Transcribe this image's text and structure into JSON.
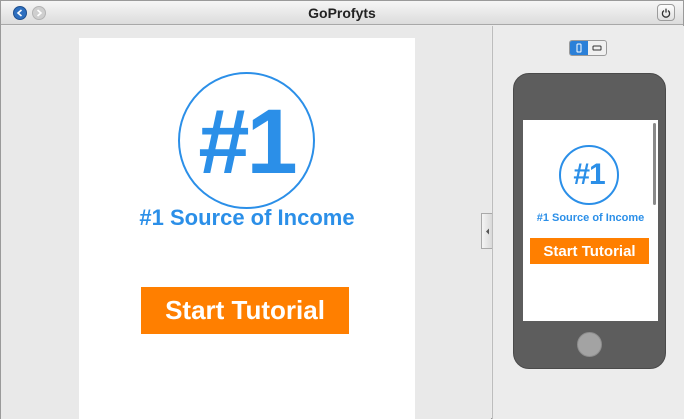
{
  "window": {
    "title": "GoProfyts"
  },
  "titlebar": {
    "back_icon": "arrow-left-icon",
    "forward_icon": "arrow-right-icon",
    "power_icon": "power-icon"
  },
  "page": {
    "badge_text": "#1",
    "headline": "#1 Source of Income",
    "start_button": "Start Tutorial"
  },
  "preview": {
    "orientation_options": [
      "portrait",
      "landscape"
    ],
    "selected_orientation": "portrait",
    "badge_text": "#1",
    "headline": "#1 Source of Income",
    "start_button": "Start Tutorial"
  },
  "colors": {
    "accent_blue": "#2b8fe8",
    "button_orange": "#ff7f00",
    "phone_body": "#5d5d5d"
  }
}
